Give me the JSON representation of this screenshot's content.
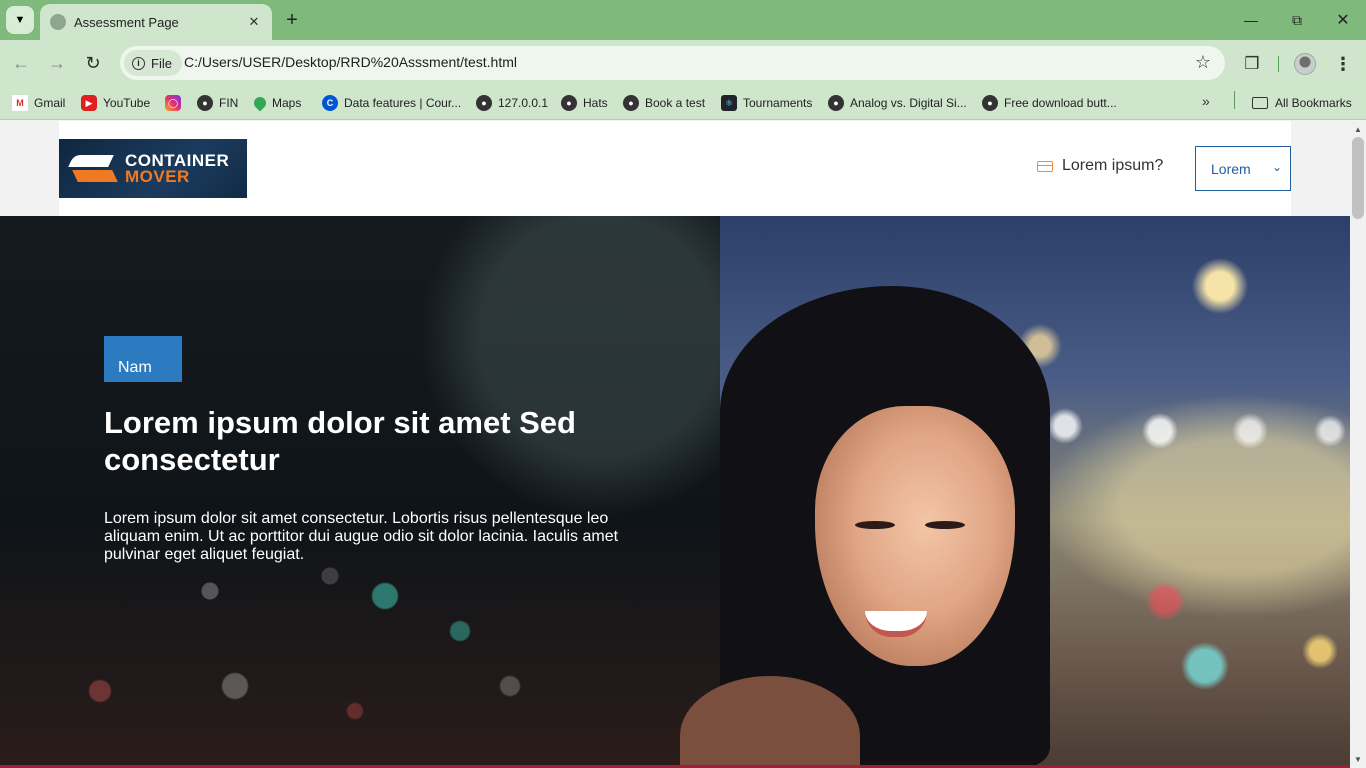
{
  "browser": {
    "tab_title": "Assessment Page",
    "site_chip": "File",
    "url": "C:/Users/USER/Desktop/RRD%20Asssment/test.html",
    "bookmarks": [
      {
        "label": "Gmail",
        "icon": "gmail-icon"
      },
      {
        "label": "YouTube",
        "icon": "youtube-icon"
      },
      {
        "label": "",
        "icon": "instagram-icon"
      },
      {
        "label": "FIN",
        "icon": "globe-icon"
      },
      {
        "label": "Maps",
        "icon": "maps-icon"
      },
      {
        "label": "Data features | Cour...",
        "icon": "coursera-icon"
      },
      {
        "label": "127.0.0.1",
        "icon": "globe-icon"
      },
      {
        "label": "Hats",
        "icon": "globe-icon"
      },
      {
        "label": "Book a test",
        "icon": "globe-icon"
      },
      {
        "label": "Tournaments",
        "icon": "react-icon"
      },
      {
        "label": "Analog vs. Digital Si...",
        "icon": "globe-icon"
      },
      {
        "label": "Free download butt...",
        "icon": "globe-icon"
      }
    ],
    "all_bookmarks": "All Bookmarks"
  },
  "site": {
    "logo": {
      "line1": "CONTAINER",
      "line2": "MOVER"
    },
    "header_cta": "Lorem ipsum?",
    "lang_select": "Lorem"
  },
  "hero": {
    "badge": "Nam",
    "title": "Lorem ipsum dolor sit amet Sed consectetur",
    "text": "Lorem ipsum dolor sit amet consectetur. Lobortis risus pellentesque leo aliquam enim. Ut ac porttitor dui augue odio sit dolor lacinia. Iaculis amet pulvinar eget aliquet feugiat."
  },
  "colors": {
    "chrome": "#7fba7c",
    "badge": "#2c7bc0",
    "accent_orange": "#f07a21"
  }
}
